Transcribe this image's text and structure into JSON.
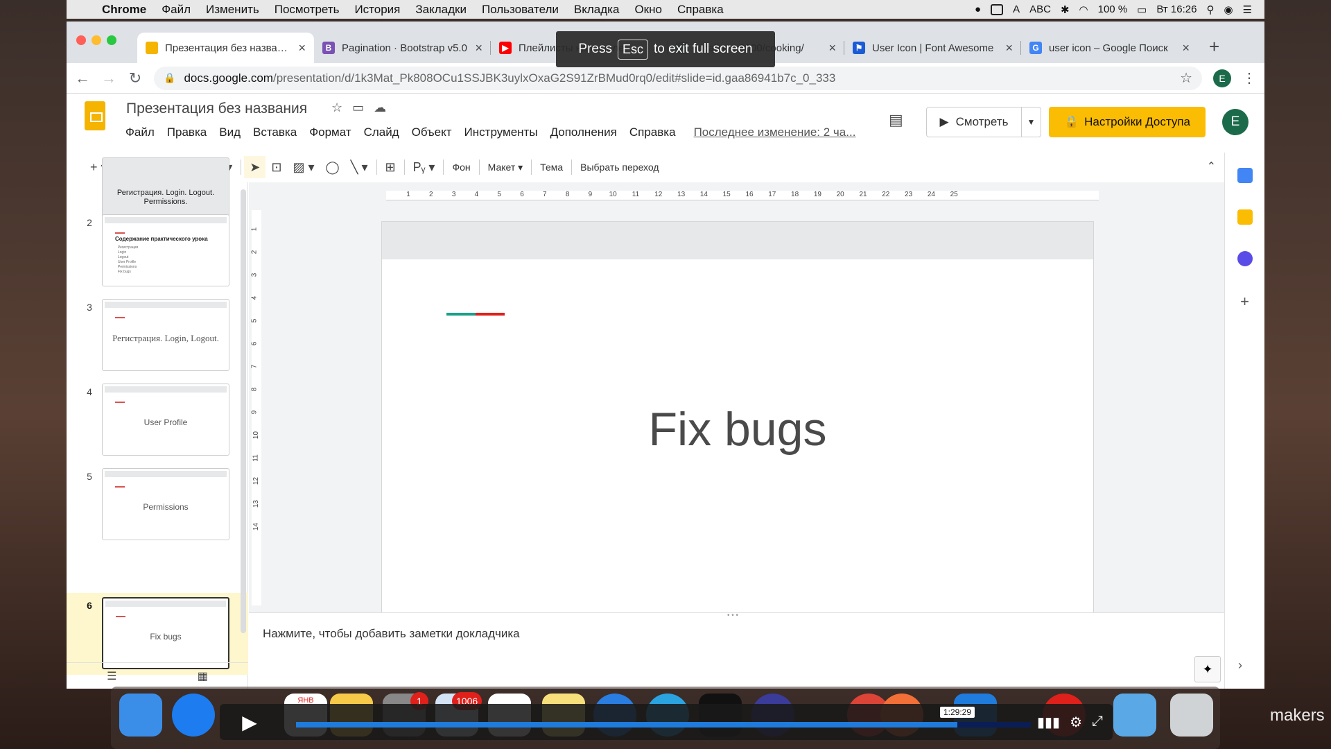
{
  "menubar": {
    "app": "Chrome",
    "items": [
      "Файл",
      "Изменить",
      "Посмотреть",
      "История",
      "Закладки",
      "Пользователи",
      "Вкладка",
      "Окно",
      "Справка"
    ],
    "input_source": "ABC",
    "battery": "100 %",
    "clock": "Вт 16:26"
  },
  "tabs": [
    {
      "title": "Презентация без названия",
      "fav_color": "#f4b400",
      "fav_glyph": ""
    },
    {
      "title": "Pagination · Bootstrap v5.0",
      "fav_color": "#7952b3",
      "fav_glyph": "B"
    },
    {
      "title": "Плейлисты на канале",
      "fav_color": "#ff0000",
      "fav_glyph": "▶"
    },
    {
      "title": "localhost:8000/cooking/",
      "fav_color": "#9aa0a6",
      "fav_glyph": "◎"
    },
    {
      "title": "User Icon | Font Awesome",
      "fav_color": "#1c5bd6",
      "fav_glyph": "⚑"
    },
    {
      "title": "user icon – Google Поиск",
      "fav_color": "#4285f4",
      "fav_glyph": "G"
    }
  ],
  "fullscreen": {
    "prefix": "Press",
    "key": "Esc",
    "suffix": "to exit full screen"
  },
  "address": {
    "host": "docs.google.com",
    "path": "/presentation/d/1k3Mat_Pk808OCu1SSJBK3uylxOxaG2S91ZrBMud0rq0/edit#slide=id.gaa86941b7c_0_333",
    "avatar": "E"
  },
  "doc": {
    "title": "Презентация без названия",
    "menu": [
      "Файл",
      "Правка",
      "Вид",
      "Вставка",
      "Формат",
      "Слайд",
      "Объект",
      "Инструменты",
      "Дополнения",
      "Справка"
    ],
    "last_edit": "Последнее изменение: 2 ча...",
    "present_label": "Смотреть",
    "share_label": "Настройки Доступа",
    "user_avatar": "E"
  },
  "toolbar": {
    "background": "Фон",
    "layout": "Макет",
    "theme": "Тема",
    "transition": "Выбрать переход"
  },
  "slides": [
    {
      "num": "",
      "text": "Регистрация. Login. Logout. Permissions."
    },
    {
      "num": "2",
      "title": "Содержание практического урока",
      "items": [
        "Регистрация",
        "Login",
        "Logout",
        "User Profile",
        "Permissions",
        "Fix bugs"
      ]
    },
    {
      "num": "3",
      "text": "Регистрация. Login, Logout."
    },
    {
      "num": "4",
      "text": "User Profile"
    },
    {
      "num": "5",
      "text": "Permissions"
    },
    {
      "num": "6",
      "text": "Fix bugs"
    }
  ],
  "ruler": {
    "h": [
      "1",
      "2",
      "3",
      "4",
      "5",
      "6",
      "7",
      "8",
      "9",
      "10",
      "11",
      "12",
      "13",
      "14",
      "15",
      "16",
      "17",
      "18",
      "19",
      "20",
      "21",
      "22",
      "23",
      "24",
      "25"
    ],
    "v": [
      "1",
      "2",
      "3",
      "4",
      "5",
      "6",
      "7",
      "8",
      "9",
      "10",
      "11",
      "12",
      "13",
      "14"
    ]
  },
  "slide": {
    "title": "Fix bugs"
  },
  "notes": {
    "placeholder": "Нажмите, чтобы добавить заметки докладчика"
  },
  "dock": {
    "calendar_month": "ЯНВ",
    "badge_1": "1",
    "badge_2": "1006"
  },
  "video": {
    "time": "1:29:29",
    "progress": 0.9
  },
  "watermark": "makers",
  "colors": {
    "accent_green": "#1aa088",
    "accent_red": "#e0201b",
    "share_yellow": "#fbbc04",
    "selected_slide_bg": "#fef7cd"
  }
}
